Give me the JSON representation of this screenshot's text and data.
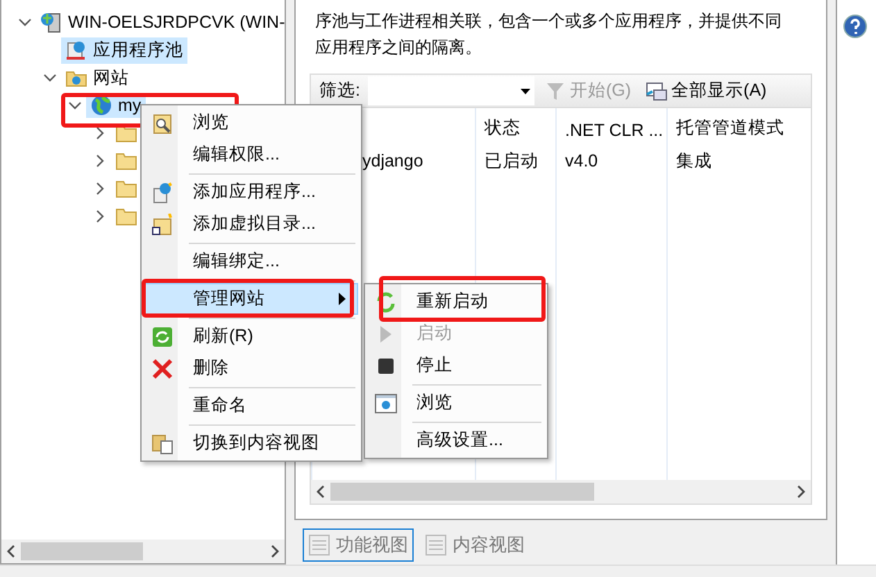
{
  "tree": [
    {
      "label": "WIN-OELSJRDPCVK (WIN-",
      "kind": "server",
      "expanded": true,
      "highlighted": false,
      "children": [
        {
          "label": "应用程序池",
          "kind": "pool",
          "highlighted": true
        },
        {
          "label": "网站",
          "kind": "sites",
          "expanded": true,
          "highlighted": false,
          "children": [
            {
              "label": "my",
              "kind": "site",
              "expanded": true,
              "highlighted": true,
              "children": [
                {
                  "kind": "folder",
                  "expanded": false
                },
                {
                  "kind": "folder",
                  "expanded": false
                },
                {
                  "kind": "folder",
                  "expanded": false
                },
                {
                  "kind": "folder",
                  "expanded": false
                }
              ]
            }
          ]
        }
      ]
    }
  ],
  "description": [
    "序池与工作进程相关联，包含一个或多个应用程序，并提供不同",
    "应用程序之间的隔离。"
  ],
  "filter": {
    "label": "筛选:",
    "go": "开始(G)",
    "go_disabled": true,
    "show_all": "全部显示(A)"
  },
  "table": {
    "columns": [
      "",
      "状态",
      ".NET CLR ...",
      "托管管道模式"
    ],
    "rows": [
      [
        "ydjango",
        "已启动",
        "v4.0",
        "集成"
      ]
    ]
  },
  "view_tabs": [
    {
      "label": "功能视图",
      "selected": true
    },
    {
      "label": "内容视图",
      "selected": false
    }
  ],
  "context_menu": [
    {
      "kind": "item",
      "label": "浏览",
      "disabled": false,
      "highlighted": false,
      "submenu": false
    },
    {
      "kind": "item",
      "label": "编辑权限...",
      "disabled": false,
      "highlighted": false,
      "submenu": false
    },
    {
      "kind": "separator"
    },
    {
      "kind": "item",
      "label": "添加应用程序...",
      "disabled": false,
      "highlighted": false,
      "submenu": false
    },
    {
      "kind": "item",
      "label": "添加虚拟目录...",
      "disabled": false,
      "highlighted": false,
      "submenu": false
    },
    {
      "kind": "separator"
    },
    {
      "kind": "item",
      "label": "编辑绑定...",
      "disabled": false,
      "highlighted": false,
      "submenu": false
    },
    {
      "kind": "separator"
    },
    {
      "kind": "item",
      "label": "管理网站",
      "disabled": false,
      "highlighted": true,
      "submenu": true
    },
    {
      "kind": "separator"
    },
    {
      "kind": "item",
      "label": "刷新(R)",
      "disabled": false,
      "highlighted": false,
      "submenu": false
    },
    {
      "kind": "item",
      "label": "删除",
      "disabled": false,
      "highlighted": false,
      "submenu": false
    },
    {
      "kind": "separator"
    },
    {
      "kind": "item",
      "label": "重命名",
      "disabled": false,
      "highlighted": false,
      "submenu": false
    },
    {
      "kind": "separator"
    },
    {
      "kind": "item",
      "label": "切换到内容视图",
      "disabled": false,
      "highlighted": false,
      "submenu": false
    }
  ],
  "submenu": [
    {
      "kind": "item",
      "label": "重新启动",
      "disabled": false,
      "highlighted": false,
      "submenu": false
    },
    {
      "kind": "item",
      "label": "启动",
      "disabled": true,
      "highlighted": false,
      "submenu": false
    },
    {
      "kind": "item",
      "label": "停止",
      "disabled": false,
      "highlighted": false,
      "submenu": false
    },
    {
      "kind": "separator"
    },
    {
      "kind": "item",
      "label": "浏览",
      "disabled": false,
      "highlighted": false,
      "submenu": false
    },
    {
      "kind": "separator"
    },
    {
      "kind": "item",
      "label": "高级设置...",
      "disabled": false,
      "highlighted": false,
      "submenu": false
    }
  ]
}
